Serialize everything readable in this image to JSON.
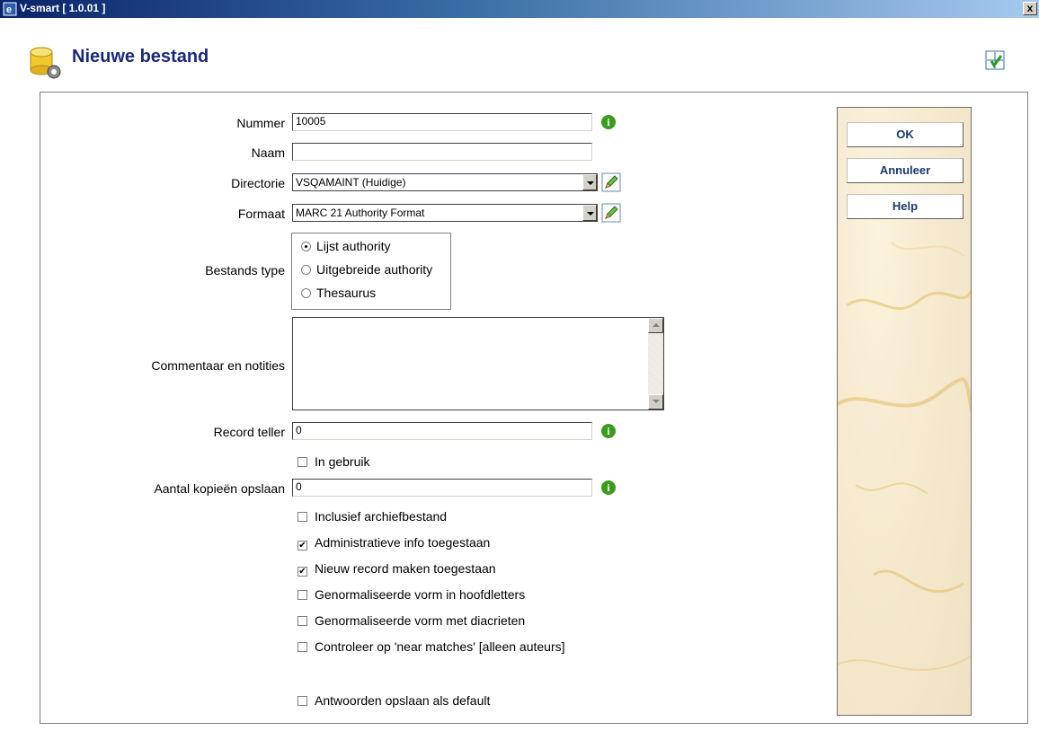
{
  "window": {
    "title": "V-smart [ 1.0.01 ]",
    "close_label": "x"
  },
  "header": {
    "title": "Nieuwe bestand"
  },
  "form": {
    "nummer": {
      "label": "Nummer",
      "value": "10005"
    },
    "naam": {
      "label": "Naam",
      "value": ""
    },
    "directorie": {
      "label": "Directorie",
      "value": "VSQAMAINT (Huidige)"
    },
    "formaat": {
      "label": "Formaat",
      "value": "MARC 21 Authority Format"
    },
    "bestands_type": {
      "label": "Bestands type",
      "options": [
        "Lijst authority",
        "Uitgebreide authority",
        "Thesaurus"
      ],
      "selected": "Lijst authority"
    },
    "commentaar": {
      "label": "Commentaar en notities",
      "value": ""
    },
    "record_teller": {
      "label": "Record teller",
      "value": "0"
    },
    "in_gebruik": {
      "label": "In gebruik",
      "checked": false
    },
    "aantal_kopieen": {
      "label": "Aantal kopieën opslaan",
      "value": "0"
    },
    "checkboxes": [
      {
        "label": "Inclusief archiefbestand",
        "checked": false
      },
      {
        "label": "Administratieve info toegestaan",
        "checked": true
      },
      {
        "label": "Nieuw record maken toegestaan",
        "checked": true
      },
      {
        "label": "Genormaliseerde vorm in hoofdletters",
        "checked": false
      },
      {
        "label": "Genormaliseerde vorm met diacrieten",
        "checked": false
      },
      {
        "label": "Controleer op 'near matches' [alleen auteurs]",
        "checked": false
      }
    ],
    "save_default": {
      "label": "Antwoorden opslaan als default",
      "checked": false
    }
  },
  "buttons": {
    "ok": "OK",
    "cancel": "Annuleer",
    "help": "Help"
  },
  "colors": {
    "title_text": "#1a2a7a",
    "info_icon": "#3b9b1e",
    "button_text": "#1a3a6a"
  }
}
